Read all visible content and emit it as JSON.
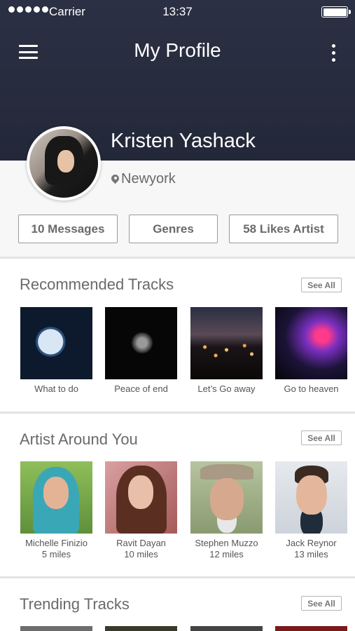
{
  "status_bar": {
    "carrier": "Carrier",
    "time": "13:37"
  },
  "header": {
    "title": "My Profile"
  },
  "profile": {
    "name": "Kristen Yashack",
    "location": "Newyork"
  },
  "stats": {
    "messages": "10 Messages",
    "genres": "Genres",
    "likes": "58 Likes Artist"
  },
  "recommended": {
    "title": "Recommended Tracks",
    "see_all": "See All",
    "items": [
      {
        "label": "What to do"
      },
      {
        "label": "Peace of end"
      },
      {
        "label": "Let’s Go away"
      },
      {
        "label": "Go to heaven"
      }
    ]
  },
  "artists": {
    "title": "Artist Around You",
    "see_all": "See All",
    "items": [
      {
        "name": "Michelle Finizio",
        "distance": "5 miles"
      },
      {
        "name": "Ravit Dayan",
        "distance": "10 miles"
      },
      {
        "name": "Stephen Muzzo",
        "distance": "12 miles"
      },
      {
        "name": "Jack Reynor",
        "distance": "13 miles"
      }
    ]
  },
  "trending": {
    "title": "Trending Tracks",
    "see_all": "See All"
  },
  "colors": {
    "header_bg": "#262b3d",
    "page_bg": "#f7f7f7",
    "text": "#6a6a6a"
  }
}
